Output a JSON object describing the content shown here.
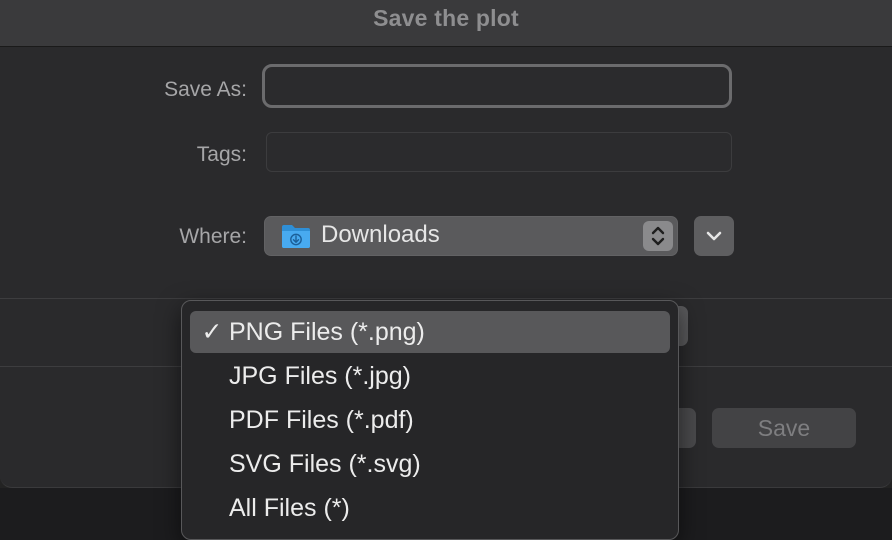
{
  "dialog": {
    "title": "Save the plot"
  },
  "form": {
    "save_as_label": "Save As:",
    "save_as_value": "",
    "tags_label": "Tags:",
    "tags_value": "",
    "where_label": "Where:",
    "where_value": "Downloads",
    "where_icon": "downloads-folder-icon",
    "stepper_icon": "up-down-chevrons-icon",
    "expand_icon": "chevron-down-icon"
  },
  "buttons": {
    "save_label": "Save"
  },
  "format_menu": {
    "items": [
      {
        "label": "PNG Files (*.png)",
        "selected": true,
        "check": "✓"
      },
      {
        "label": "JPG Files (*.jpg)",
        "selected": false
      },
      {
        "label": "PDF Files (*.pdf)",
        "selected": false
      },
      {
        "label": "SVG Files (*.svg)",
        "selected": false
      },
      {
        "label": "All Files (*)",
        "selected": false
      }
    ]
  },
  "colors": {
    "folder_blue": "#3aa2ea",
    "menu_highlight": "#58585a"
  }
}
